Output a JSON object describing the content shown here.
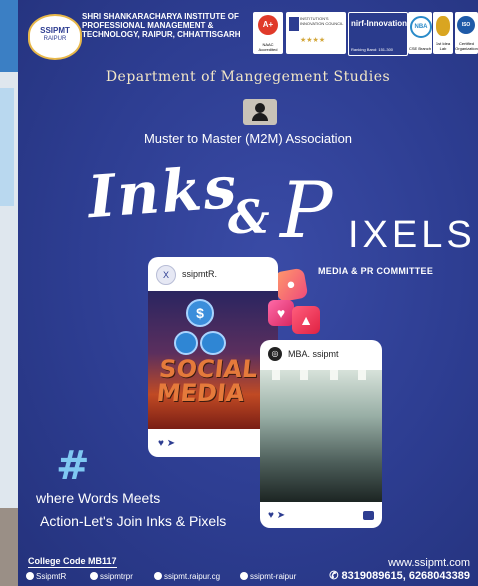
{
  "header": {
    "logo_main": "SSIPMT",
    "logo_sub": "RAIPUR",
    "institute_line1": "SHRI SHANKARACHARYA INSTITUTE OF",
    "institute_line2": "PROFESSIONAL MANAGEMENT &",
    "institute_line3": "TECHNOLOGY, RAIPUR, CHHATTISGARH",
    "naac_grade": "A+",
    "naac_caption": "NAAC Accredited",
    "iic_caption": "INSTITUTION'S INNOVATION COUNCIL",
    "iic_stars": "★★★★",
    "nirf_label": "nirf-Innovation",
    "nirf_rank": "Ranking Band: 151-300",
    "nba_label": "NBA",
    "nba_caption": "CSE Branch",
    "gold_caption": "1st Idea Lab",
    "iso_label": "ISO",
    "iso_caption": "Certified Organization"
  },
  "department": "Department of Mangegement Studies",
  "association": "Muster to Master (M2M) Association",
  "title_inks": "Inks",
  "title_amp": "&",
  "title_p": "P",
  "title_xels": "IXELS",
  "committee": "MEDIA & PR COMMITTEE",
  "card1": {
    "avatar_icon": "x-logo-icon",
    "avatar_glyph": "X",
    "username": "ssipmtR.",
    "image_text_line1": "SOCIAL",
    "image_text_line2": "MEDIA",
    "dollar_glyph": "$"
  },
  "card2": {
    "avatar_glyph": "◎",
    "username": "MBA. ssipmt"
  },
  "hashtag": "#",
  "tagline_line1": "where Words Meets",
  "tagline_line2": "Action-Let's Join Inks & Pixels",
  "college_code": "College Code MB117",
  "website": "www.ssipmt.com",
  "footer": {
    "twitter": "SsipmtR",
    "facebook": "ssipmtrpr",
    "instagram": "ssipmt.raipur.cg",
    "linkedin": "ssipmt-raipur",
    "phone": "8319089615, 6268043389"
  },
  "colors": {
    "background": "#2d3d91",
    "accent_blue": "#7fc8f2",
    "department_text": "#f2e6c6"
  }
}
